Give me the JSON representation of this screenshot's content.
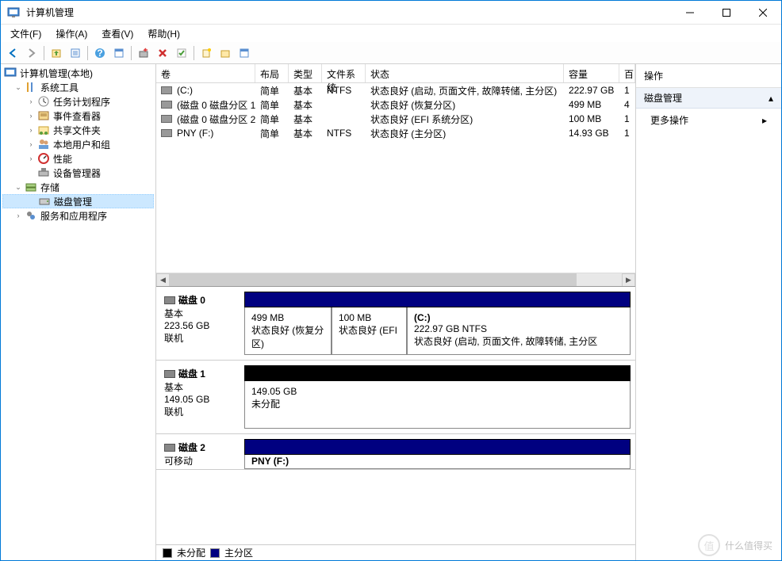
{
  "window": {
    "title": "计算机管理"
  },
  "menu": {
    "file": "文件(F)",
    "action": "操作(A)",
    "view": "查看(V)",
    "help": "帮助(H)"
  },
  "tree": {
    "root": "计算机管理(本地)",
    "systools": "系统工具",
    "task_scheduler": "任务计划程序",
    "event_viewer": "事件查看器",
    "shared_folders": "共享文件夹",
    "local_users": "本地用户和组",
    "performance": "性能",
    "device_manager": "设备管理器",
    "storage": "存储",
    "disk_mgmt": "磁盘管理",
    "services_apps": "服务和应用程序"
  },
  "columns": {
    "volume": "卷",
    "layout": "布局",
    "type": "类型",
    "fs": "文件系统",
    "status": "状态",
    "capacity": "容量",
    "last": "百"
  },
  "volumes": [
    {
      "name": "(C:)",
      "layout": "简单",
      "type": "基本",
      "fs": "NTFS",
      "status": "状态良好 (启动, 页面文件, 故障转储, 主分区)",
      "capacity": "222.97 GB",
      "last": "1"
    },
    {
      "name": "(磁盘 0 磁盘分区 1)",
      "layout": "简单",
      "type": "基本",
      "fs": "",
      "status": "状态良好 (恢复分区)",
      "capacity": "499 MB",
      "last": "4"
    },
    {
      "name": "(磁盘 0 磁盘分区 2)",
      "layout": "简单",
      "type": "基本",
      "fs": "",
      "status": "状态良好 (EFI 系统分区)",
      "capacity": "100 MB",
      "last": "1"
    },
    {
      "name": "PNY (F:)",
      "layout": "简单",
      "type": "基本",
      "fs": "NTFS",
      "status": "状态良好 (主分区)",
      "capacity": "14.93 GB",
      "last": "1"
    }
  ],
  "disks": {
    "disk0": {
      "label": "磁盘 0",
      "type": "基本",
      "size": "223.56 GB",
      "state": "联机",
      "p1_size": "499 MB",
      "p1_status": "状态良好 (恢复分区)",
      "p2_size": "100 MB",
      "p2_status": "状态良好 (EFI",
      "p3_title": "(C:)",
      "p3_size": "222.97 GB NTFS",
      "p3_status": "状态良好 (启动, 页面文件, 故障转储, 主分区"
    },
    "disk1": {
      "label": "磁盘 1",
      "type": "基本",
      "size": "149.05 GB",
      "state": "联机",
      "p1_size": "149.05 GB",
      "p1_status": "未分配"
    },
    "disk2": {
      "label": "磁盘 2",
      "type": "可移动",
      "p1_title": "PNY  (F:)"
    }
  },
  "legend": {
    "unallocated": "未分配",
    "primary": "主分区"
  },
  "actions": {
    "header": "操作",
    "section": "磁盘管理",
    "more": "更多操作"
  },
  "watermark": {
    "text": "什么值得买",
    "badge": "值"
  }
}
